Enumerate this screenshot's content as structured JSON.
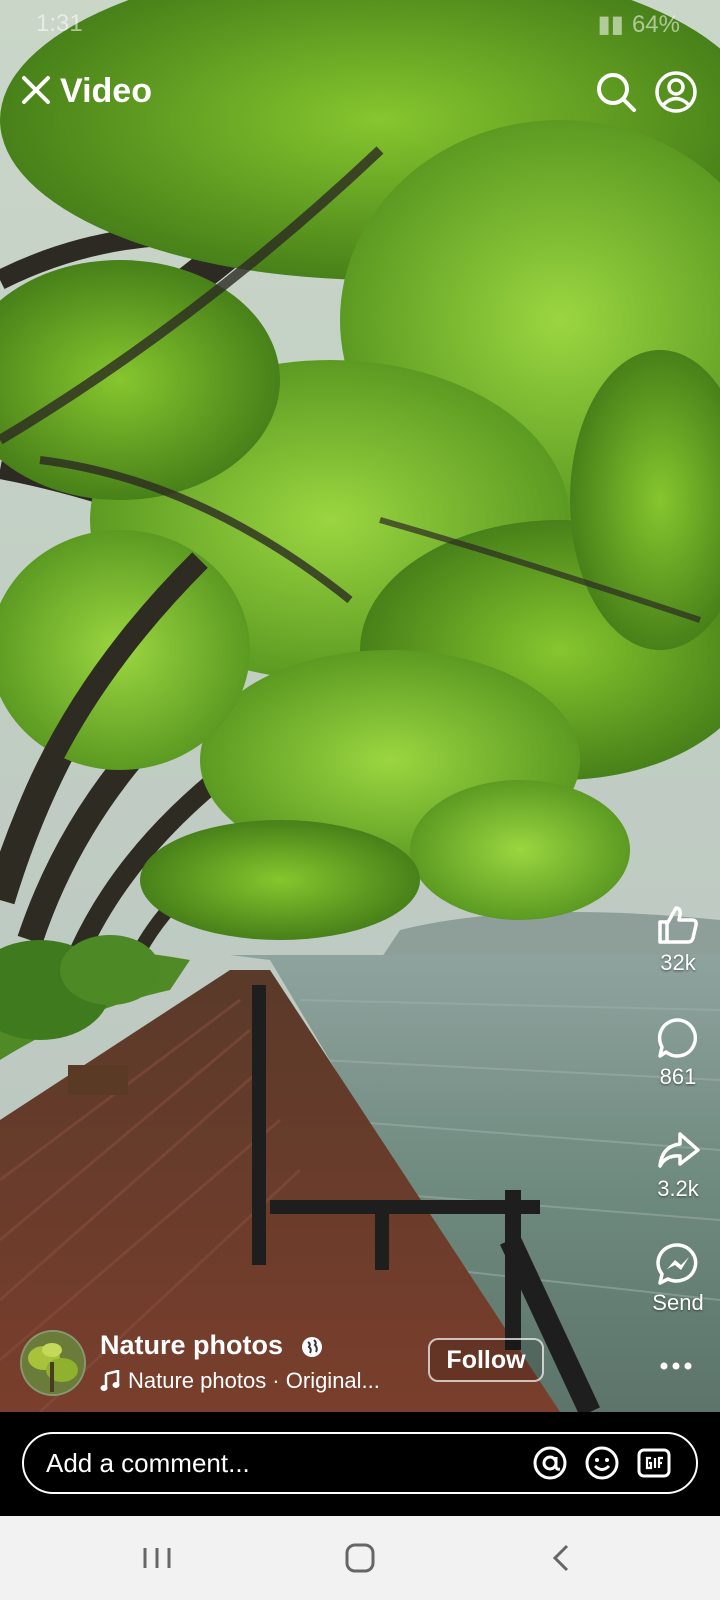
{
  "status_bar": {
    "time": "1:31",
    "battery": "64%"
  },
  "header": {
    "title": "Video"
  },
  "actions": {
    "like_count": "32k",
    "comment_count": "861",
    "share_count": "3.2k",
    "send_label": "Send"
  },
  "channel": {
    "name": "Nature photos",
    "audio": "Nature photos · Original...",
    "follow_label": "Follow"
  },
  "comment": {
    "placeholder": "Add a comment..."
  },
  "icons": [
    "close-icon",
    "search-icon",
    "profile-icon",
    "like-icon",
    "comment-icon",
    "share-icon",
    "messenger-icon",
    "more-icon",
    "globe-icon",
    "music-icon",
    "mention-icon",
    "emoji-icon",
    "gif-icon",
    "recent-apps-icon",
    "home-icon",
    "back-icon"
  ]
}
